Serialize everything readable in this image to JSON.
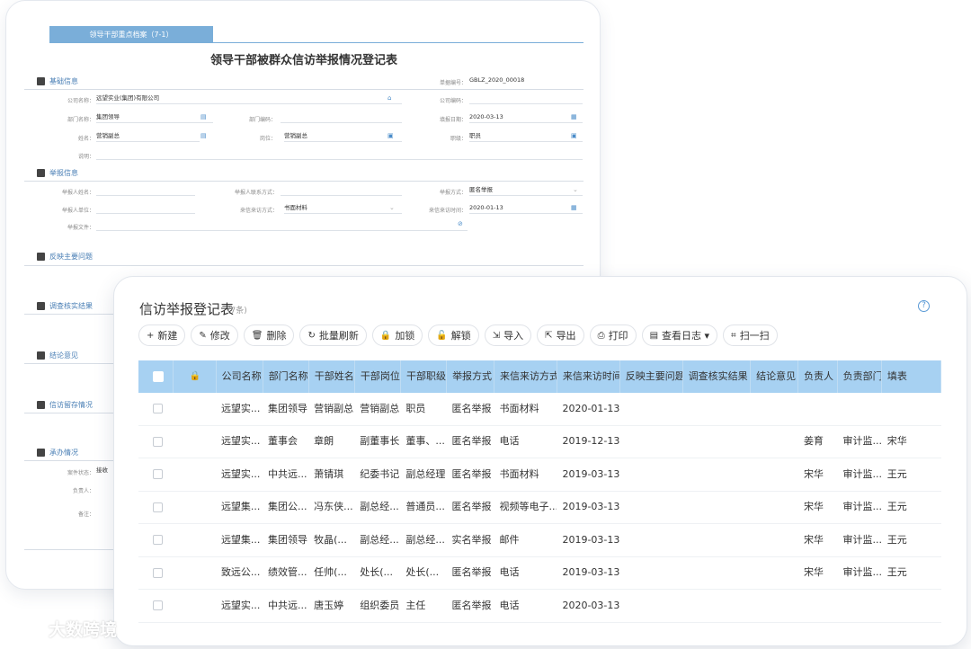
{
  "back_form": {
    "tab_label": "领导干部重点档案（7-1）",
    "title": "领导干部被群众信访举报情况登记表",
    "sections": {
      "basic": "基础信息",
      "report": "举报信息",
      "issue": "反映主要问题",
      "verify": "调查核实结果",
      "conclusion": "结论意见",
      "storage": "信访留存情况",
      "handling": "承办情况"
    },
    "fields": {
      "company_label": "公司名称：",
      "company_value": "远望实业(集团)有限公司",
      "doc_no_label": "单据编号：",
      "doc_no_value": "GBLZ_2020_00018",
      "company_code_label": "公司编码：",
      "dept_label": "部门名称：",
      "dept_value": "集团领导",
      "dept_code_label": "部门编码：",
      "fill_date_label": "填报日期：",
      "fill_date_value": "2020-03-13",
      "name_label": "姓名：",
      "name_value": "营销副总",
      "post_label": "岗位：",
      "post_value": "营销副总",
      "rank_label": "职级：",
      "rank_value": "职员",
      "notes_label": "说明：",
      "reporter_name_label": "举报人姓名：",
      "reporter_contact_label": "举报人联系方式：",
      "report_method_label": "举报方式：",
      "report_method_value": "匿名举报",
      "reporter_unit_label": "举报人单位：",
      "visit_method_label": "来信来访方式：",
      "visit_method_value": "书面材料",
      "visit_time_label": "来信来访时间：",
      "visit_time_value": "2020-01-13",
      "report_file_label": "举报文件：",
      "case_status_label": "案件状态：",
      "case_status_value": "接收",
      "owner_label": "负责人：",
      "remark_label": "备注："
    }
  },
  "list": {
    "title": "信访举报登记表",
    "count": "(7条)",
    "help_icon": "?",
    "toolbar": [
      {
        "icon": "+",
        "label": "新建"
      },
      {
        "icon": "✎",
        "label": "修改"
      },
      {
        "icon": "🗑",
        "label": "删除"
      },
      {
        "icon": "↻",
        "label": "批量刷新"
      },
      {
        "icon": "🔒",
        "label": "加锁"
      },
      {
        "icon": "🔓",
        "label": "解锁"
      },
      {
        "icon": "⇲",
        "label": "导入"
      },
      {
        "icon": "⇱",
        "label": "导出"
      },
      {
        "icon": "⎙",
        "label": "打印"
      },
      {
        "icon": "▤",
        "label": "查看日志 ▾"
      },
      {
        "icon": "⌗",
        "label": "扫一扫"
      }
    ],
    "columns": [
      "",
      "",
      "公司名称",
      "部门名称",
      "干部姓名",
      "干部岗位",
      "干部职级",
      "举报方式",
      "来信来访方式",
      "来信来访时间",
      "反映主要问题",
      "调查核实结果",
      "结论意见",
      "负责人",
      "负责部门",
      "填表"
    ],
    "rows": [
      [
        "远望实...",
        "集团领导",
        "营销副总",
        "营销副总",
        "职员",
        "匿名举报",
        "书面材料",
        "2020-01-13",
        "",
        "",
        "",
        "",
        "",
        ""
      ],
      [
        "远望实...",
        "董事会",
        "章朗",
        "副董事长",
        "董事、...",
        "匿名举报",
        "电话",
        "2019-12-13",
        "",
        "",
        "",
        "姜育",
        "审计监...",
        "宋华"
      ],
      [
        "远望实...",
        "中共远...",
        "萧锖琪",
        "纪委书记",
        "副总经理",
        "匿名举报",
        "书面材料",
        "2019-03-13",
        "",
        "",
        "",
        "宋华",
        "审计监...",
        "王元"
      ],
      [
        "远望集...",
        "集团公...",
        "冯东侠...",
        "副总经...",
        "普通员...",
        "匿名举报",
        "视频等电子...",
        "2019-03-13",
        "",
        "",
        "",
        "宋华",
        "审计监...",
        "王元"
      ],
      [
        "远望集...",
        "集团领导",
        "牧晶(...",
        "副总经...",
        "副总经...",
        "实名举报",
        "邮件",
        "2019-03-13",
        "",
        "",
        "",
        "宋华",
        "审计监...",
        "王元"
      ],
      [
        "致远公...",
        "绩效管...",
        "任帅(...",
        "处长(...",
        "处长(...",
        "匿名举报",
        "电话",
        "2019-03-13",
        "",
        "",
        "",
        "宋华",
        "审计监...",
        "王元"
      ],
      [
        "远望实...",
        "中共远...",
        "唐玉婷",
        "组织委员",
        "主任",
        "匿名举报",
        "电话",
        "2020-03-13",
        "",
        "",
        "",
        "",
        "",
        ""
      ]
    ]
  },
  "watermark": {
    "text": "大数跨境"
  },
  "colors": {
    "header_bg": "#a7d1f2",
    "accent": "#4a8cc9"
  }
}
